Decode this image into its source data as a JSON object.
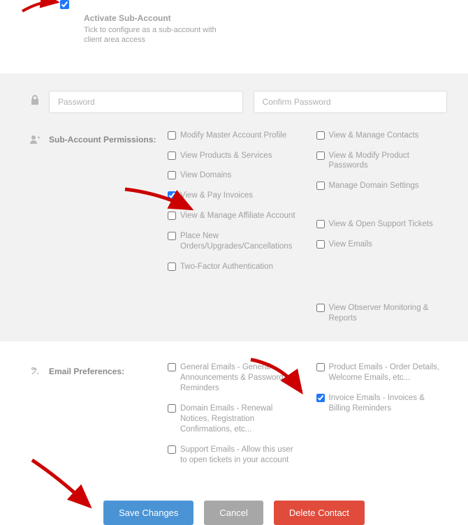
{
  "activate": {
    "label": "Activate Sub-Account",
    "desc": "Tick to configure as a sub-account with client area access",
    "checked": true
  },
  "password": {
    "placeholder": "Password"
  },
  "confirm": {
    "placeholder": "Confirm Password"
  },
  "permissions": {
    "heading": "Sub-Account Permissions:",
    "left": [
      {
        "label": "Modify Master Account Profile",
        "checked": false
      },
      {
        "label": "View Products & Services",
        "checked": false
      },
      {
        "label": "View Domains",
        "checked": false
      },
      {
        "label": "View & Pay Invoices",
        "checked": true
      },
      {
        "label": "View & Manage Affiliate Account",
        "checked": false
      },
      {
        "label": "Place New Orders/Upgrades/Cancellations",
        "checked": false
      },
      {
        "label": "Two-Factor Authentication",
        "checked": false
      }
    ],
    "right": [
      {
        "label": "View & Manage Contacts",
        "checked": false
      },
      {
        "label": "View & Modify Product Passwords",
        "checked": false
      },
      {
        "label": "Manage Domain Settings",
        "checked": false
      },
      {
        "label": "View & Open Support Tickets",
        "checked": false
      },
      {
        "label": "View Emails",
        "checked": false
      },
      {
        "label": "View Observer Monitoring & Reports",
        "checked": false
      }
    ]
  },
  "email_prefs": {
    "heading": "Email Preferences:",
    "left": [
      {
        "label": "General Emails - General Announcements & Password Reminders",
        "checked": false
      },
      {
        "label": "Domain Emails - Renewal Notices, Registration Confirmations, etc...",
        "checked": false
      },
      {
        "label": "Support Emails - Allow this user to open tickets in your account",
        "checked": false
      }
    ],
    "right": [
      {
        "label": "Product Emails - Order Details, Welcome Emails, etc...",
        "checked": false
      },
      {
        "label": "Invoice Emails - Invoices & Billing Reminders",
        "checked": true
      }
    ]
  },
  "buttons": {
    "save": "Save Changes",
    "cancel": "Cancel",
    "delete": "Delete Contact"
  }
}
